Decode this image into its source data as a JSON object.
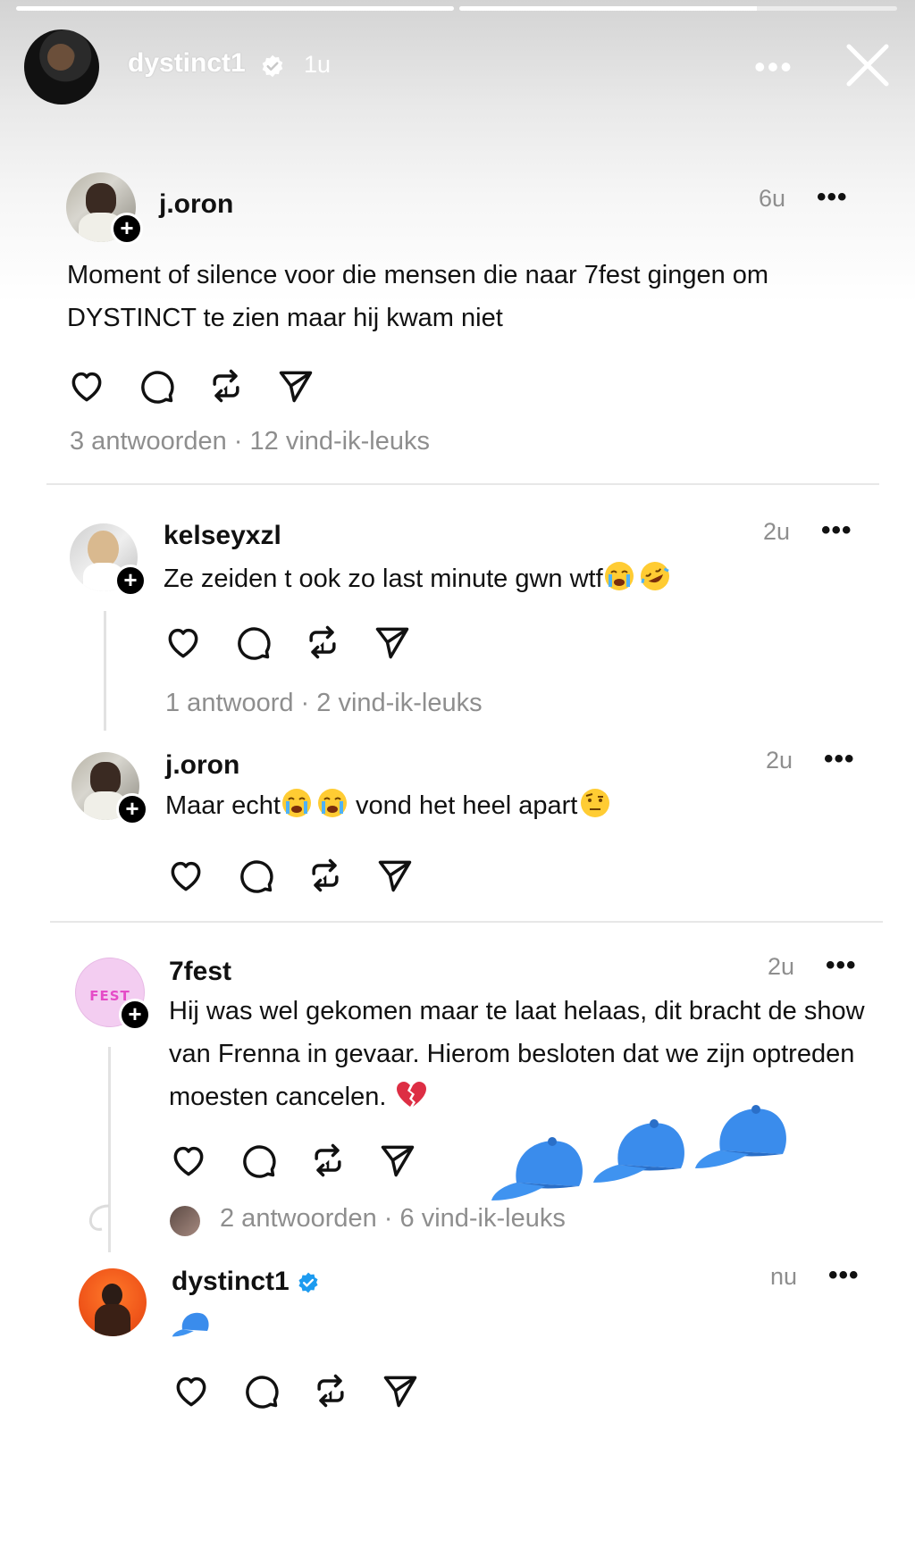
{
  "story": {
    "username": "dystinct1",
    "time": "1u",
    "progress": [
      1.0,
      0.68
    ]
  },
  "posts": [
    {
      "username": "j.oron",
      "time": "6u",
      "text": "Moment of silence voor die mensen die naar 7fest gingen om DYSTINCT te zien maar hij kwam niet",
      "meta": "3 antwoorden · 12 vind-ik-leuks"
    },
    {
      "username": "kelseyxzl",
      "time": "2u",
      "text": "Ze zeiden t ook zo last minute gwn wtf",
      "emojis": [
        "loudly-crying-face",
        "rolling-on-floor-laughing"
      ],
      "meta": "1 antwoord · 2 vind-ik-leuks"
    },
    {
      "username": "j.oron",
      "time": "2u",
      "text_a": "Maar echt",
      "text_b": " vond het heel apart",
      "emojis": [
        "loudly-crying-face",
        "loudly-crying-face",
        "face-with-raised-eyebrow"
      ]
    },
    {
      "username": "7fest",
      "avatar_text": "FEST",
      "time": "2u",
      "text": "Hij was wel gekomen maar te laat helaas, dit bracht de show van Frenna in gevaar. Hierom besloten dat we zijn optreden moesten cancelen.",
      "emojis": [
        "broken-heart"
      ],
      "meta": "2 antwoorden · 6 vind-ik-leuks"
    },
    {
      "username": "dystinct1",
      "verified": true,
      "time": "nu",
      "emojis": [
        "billed-cap"
      ]
    }
  ],
  "stickers": [
    "billed-cap",
    "billed-cap",
    "billed-cap"
  ],
  "colors": {
    "verified": "#1d9bf0",
    "muted": "#8e8e8e",
    "cap": "#2f7fe0"
  }
}
